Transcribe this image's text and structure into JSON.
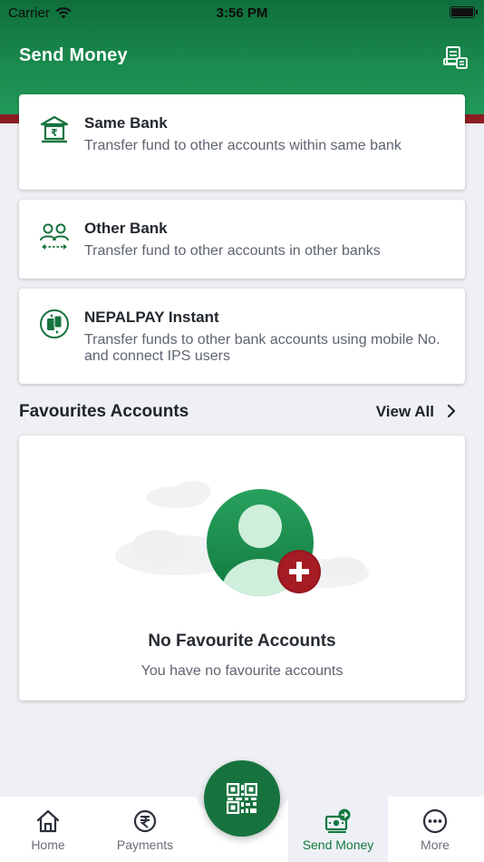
{
  "status_bar": {
    "carrier": "Carrier",
    "time": "3:56 PM"
  },
  "header": {
    "title": "Send Money",
    "action_icon": "statement-icon"
  },
  "colors": {
    "primary": "#17733e",
    "accent_red": "#8c1d22",
    "background": "#eef0f5"
  },
  "transfer_options": [
    {
      "title": "Same Bank",
      "description": "Transfer fund to other accounts within same bank",
      "icon": "bank-icon"
    },
    {
      "title": "Other Bank",
      "description": "Transfer fund to other accounts in other banks",
      "icon": "users-transfer-icon"
    },
    {
      "title": "NEPALPAY Instant",
      "description": "Transfer funds to other bank accounts using mobile No. and connect IPS users",
      "icon": "phone-transfer-icon"
    }
  ],
  "favourites": {
    "title": "Favourites Accounts",
    "view_all": "View All",
    "empty_title": "No Favourite Accounts",
    "empty_desc": "You have no favourite accounts"
  },
  "tabs": [
    {
      "label": "Home",
      "icon": "home-icon"
    },
    {
      "label": "Payments",
      "icon": "payments-icon"
    },
    {
      "label": "Send Money",
      "icon": "send-money-icon",
      "active": true
    },
    {
      "label": "More",
      "icon": "more-icon"
    }
  ],
  "fab": {
    "icon": "qr-code-icon"
  }
}
